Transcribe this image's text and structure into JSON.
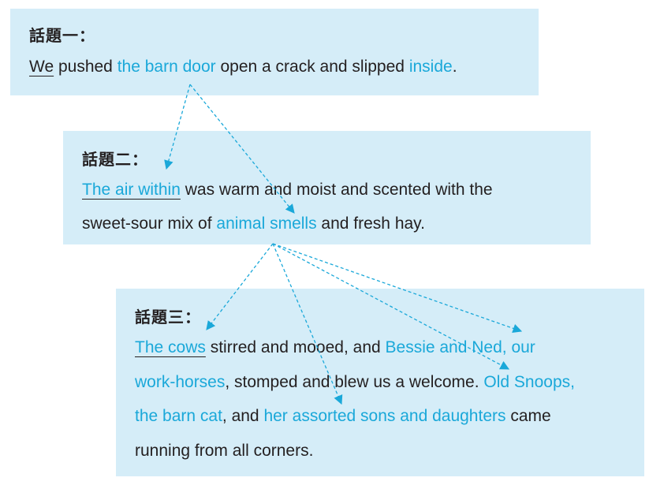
{
  "topics": [
    {
      "label": "話題一：",
      "lines": [
        [
          {
            "text": "We",
            "style": "underline"
          },
          {
            "text": " pushed ",
            "style": "plain"
          },
          {
            "text": "the barn door",
            "style": "highlight"
          },
          {
            "text": " open a crack and slipped ",
            "style": "plain"
          },
          {
            "text": "inside",
            "style": "highlight"
          },
          {
            "text": ".",
            "style": "plain"
          }
        ]
      ]
    },
    {
      "label": "話題二：",
      "lines": [
        [
          {
            "text": "The air within",
            "style": "highlight-underline"
          },
          {
            "text": " was warm and moist and scented with the",
            "style": "plain"
          }
        ],
        [
          {
            "text": "sweet-sour mix of ",
            "style": "plain"
          },
          {
            "text": "animal smells",
            "style": "highlight"
          },
          {
            "text": " and fresh hay.",
            "style": "plain"
          }
        ]
      ]
    },
    {
      "label": "話題三：",
      "lines": [
        [
          {
            "text": "The cows",
            "style": "highlight-underline"
          },
          {
            "text": " stirred and mooed, and ",
            "style": "plain"
          },
          {
            "text": "Bessie and Ned, our",
            "style": "highlight"
          }
        ],
        [
          {
            "text": "work-horses",
            "style": "highlight"
          },
          {
            "text": ", stomped and blew us a welcome. ",
            "style": "plain"
          },
          {
            "text": "Old Snoops,",
            "style": "highlight"
          }
        ],
        [
          {
            "text": "the barn cat",
            "style": "highlight"
          },
          {
            "text": ", and ",
            "style": "plain"
          },
          {
            "text": "her assorted sons and daughters",
            "style": "highlight"
          },
          {
            "text": " came",
            "style": "plain"
          }
        ],
        [
          {
            "text": "running from all corners.",
            "style": "plain"
          }
        ]
      ]
    }
  ],
  "colors": {
    "box_background": "#d5edf8",
    "highlight_text": "#1aa8d9",
    "body_text": "#231f20",
    "arrow": "#1aa8d9"
  },
  "arrow_style": "dashed"
}
